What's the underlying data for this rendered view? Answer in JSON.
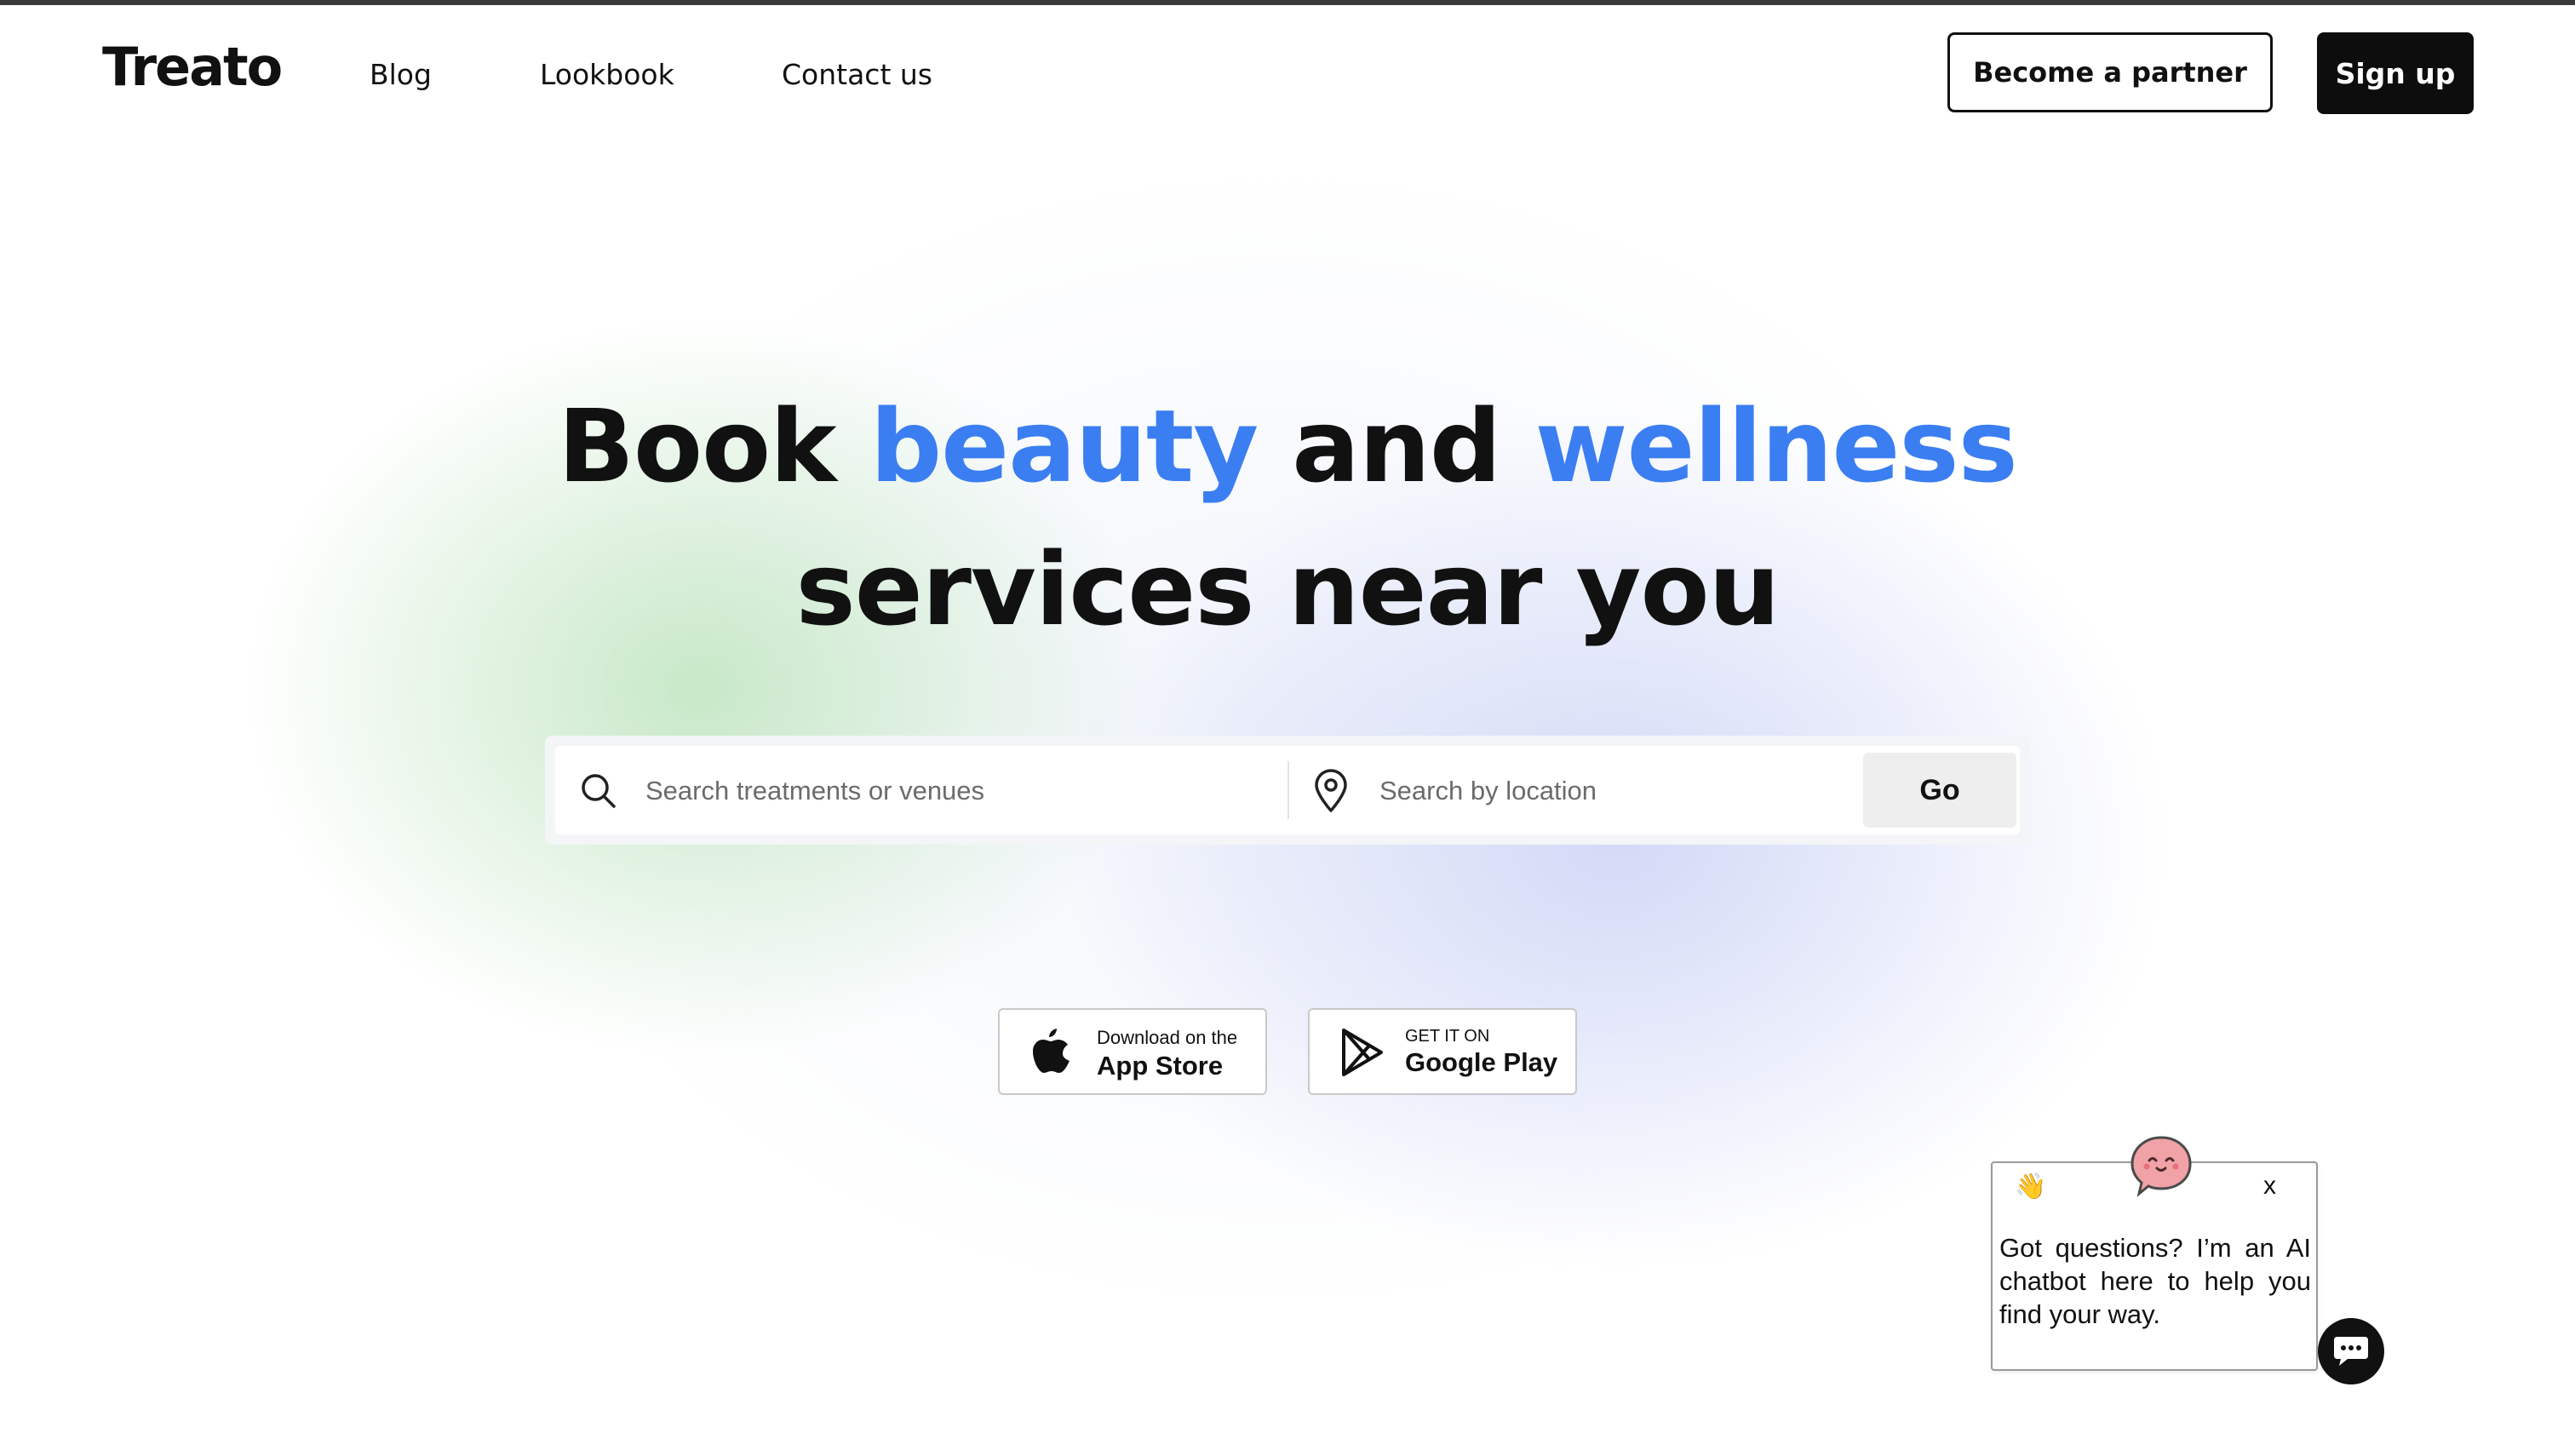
{
  "brand": {
    "logo_text": "Treato"
  },
  "nav": {
    "links": [
      "Blog",
      "Lookbook",
      "Contact us"
    ],
    "partner_button": "Become a partner",
    "signup_button": "Sign up"
  },
  "hero": {
    "headline": {
      "part1": "Book ",
      "accent1": "beauty",
      "part2": " and ",
      "accent2": "wellness",
      "line2": "services near you"
    },
    "accent_color": "#3a7ef2"
  },
  "search": {
    "treatments_placeholder": "Search treatments or venues",
    "location_placeholder": "Search by location",
    "go_label": "Go",
    "icons": [
      "search-icon",
      "location-pin-icon"
    ]
  },
  "stores": {
    "apple": {
      "small": "Download on the",
      "big": "App Store",
      "icon": "apple-icon"
    },
    "google": {
      "small": "GET IT ON",
      "big": "Google Play",
      "icon": "google-play-icon"
    }
  },
  "chatbot": {
    "wave_emoji": "👋",
    "close_label": "x",
    "message": "Got questions? I’m an AI chatbot here to help you find your way.",
    "avatar_icon": "chatbot-face-icon",
    "launcher_icon": "chat-bubble-icon"
  }
}
